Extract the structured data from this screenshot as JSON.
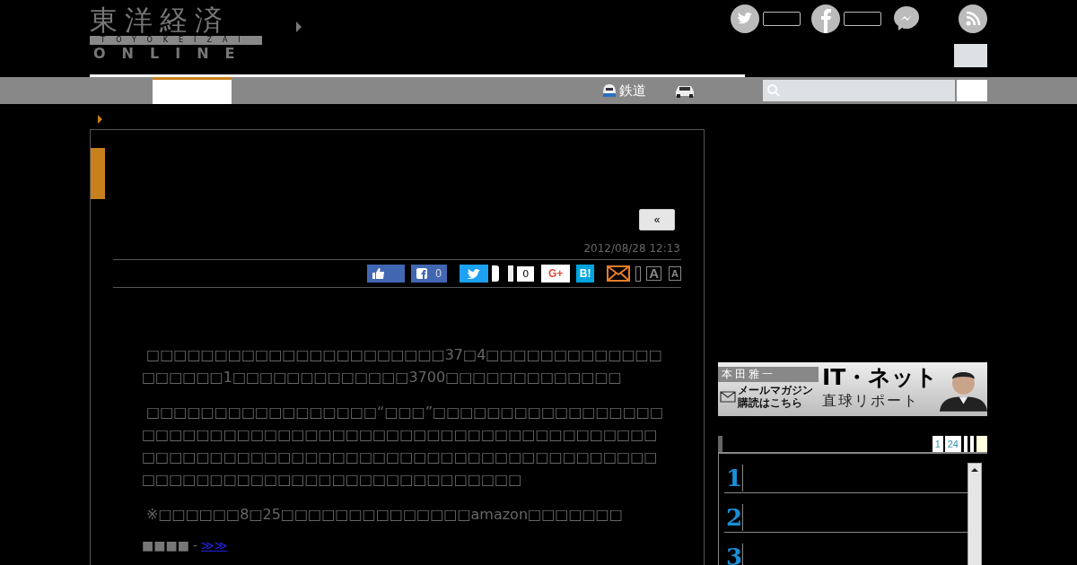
{
  "logo": {
    "title": "東洋経済",
    "subtitle": "TOYOKEIZAI",
    "edition": "ONLINE"
  },
  "nav": {
    "tabs": [
      {
        "selected": true
      }
    ],
    "links": [
      {
        "kind": "rail",
        "label": "鉄道"
      },
      {
        "kind": "car"
      }
    ]
  },
  "article": {
    "back_button": "«",
    "date": "2012/08/28 12:13",
    "share": [
      {
        "kind": "like"
      },
      {
        "kind": "facebook",
        "count": "0"
      },
      {
        "kind": "tweet"
      },
      {
        "kind": "pocket",
        "count": "0"
      },
      {
        "kind": "gplus",
        "label": "G+"
      },
      {
        "kind": "hatena",
        "label": "B!"
      },
      {
        "kind": "mail"
      },
      {
        "kind": "font-large",
        "label": "A"
      },
      {
        "kind": "font-small",
        "label": "A"
      }
    ],
    "paragraphs": [
      " □□□□□□□□□□□□□□□□□□□□□□37□4□□□□□□□□□□□□□□□□□□□1□□□□□□□□□□□□□3700□□□□□□□□□□□□□",
      " □□□□□□□□□□□□□□□□□“□□□”□□□□□□□□□□□□□□□□□□□□□□□□□□□□□□□□□□□□□□□□□□□□□□□□□□□□□□□□□□□□□□□□□□□□□□□□□□□□□□□□□□□□□□□□□□□□□□□□□□□□□□□□□□□□□□□□□□□□□□□□□",
      " ※□□□□□□8□25□□□□□□□□□□□□□□amazon□□□□□□□"
    ],
    "footer": {
      "marks": "■■■■",
      "separator": "-",
      "link": "≫≫"
    }
  },
  "sidebar": {
    "banner": {
      "author": "本田雅一",
      "title": "IT・ネット",
      "subtitle": "直球リポート",
      "mail": "メールマガジン",
      "mail_action": "購読はこちら"
    },
    "ranking": {
      "tabs": [
        "1",
        "24"
      ],
      "items": [
        {
          "rank": "1"
        },
        {
          "rank": "2"
        },
        {
          "rank": "3"
        }
      ]
    }
  }
}
